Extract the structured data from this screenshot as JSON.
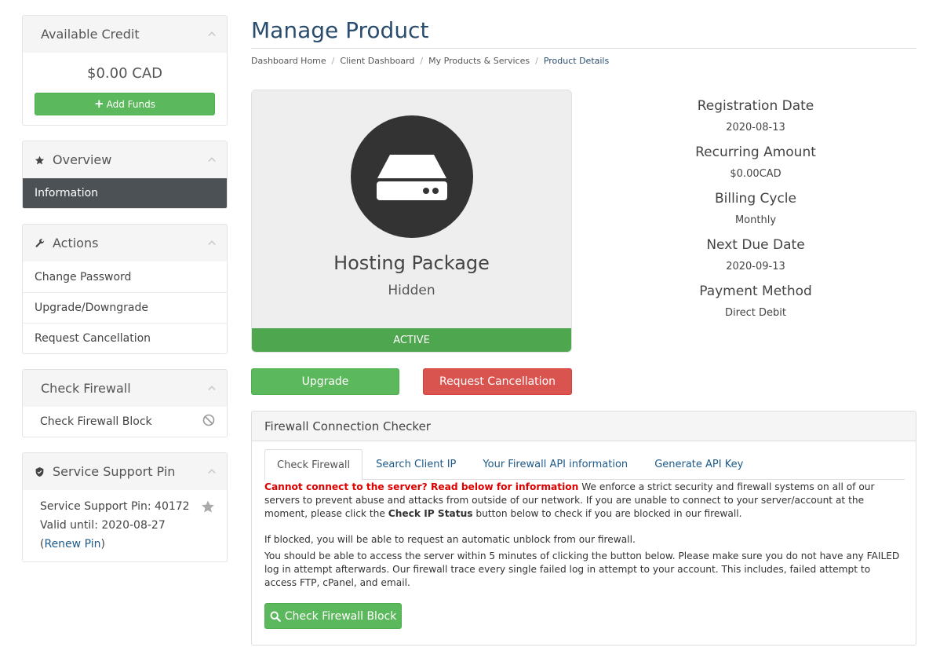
{
  "sidebar": {
    "credit": {
      "title": "Available Credit",
      "amount": "$0.00 CAD",
      "add_funds": "Add Funds"
    },
    "overview": {
      "title": "Overview",
      "active_item": "Information"
    },
    "actions": {
      "title": "Actions",
      "items": [
        "Change Password",
        "Upgrade/Downgrade",
        "Request Cancellation"
      ]
    },
    "firewall": {
      "title": "Check Firewall",
      "item": "Check Firewall Block"
    },
    "support_pin": {
      "title": "Service Support Pin",
      "pin_line": "Service Support Pin: 40172",
      "valid_line": "Valid until: 2020-08-27",
      "open_paren": "(",
      "renew": "Renew Pin",
      "close_paren": ")"
    }
  },
  "page": {
    "title": "Manage Product",
    "breadcrumb": [
      "Dashboard Home",
      "Client Dashboard",
      "My Products & Services",
      "Product Details"
    ],
    "breadcrumb_sep": "/"
  },
  "product": {
    "name": "Hosting Package",
    "subtitle": "Hidden",
    "status": "ACTIVE",
    "icon": "server-icon"
  },
  "buttons": {
    "upgrade": "Upgrade",
    "cancel": "Request Cancellation"
  },
  "details": [
    {
      "label": "Registration Date",
      "value": "2020-08-13"
    },
    {
      "label": "Recurring Amount",
      "value": "$0.00CAD"
    },
    {
      "label": "Billing Cycle",
      "value": "Monthly"
    },
    {
      "label": "Next Due Date",
      "value": "2020-09-13"
    },
    {
      "label": "Payment Method",
      "value": "Direct Debit"
    }
  ],
  "firewall_panel": {
    "title": "Firewall Connection Checker",
    "tabs": [
      "Check Firewall",
      "Search Client IP",
      "Your Firewall API information",
      "Generate API Key"
    ],
    "warning": "Cannot connect to the server? Read below for information",
    "para1_a": " We enforce a strict security and firewall systems on all of our servers to prevent abuse and attacks from outside of our network. If you are unable to connect to your server/account at the moment, please click the ",
    "para1_bold": "Check IP Status",
    "para1_b": " button below to check if you are blocked in our firewall.",
    "para2": "If blocked, you will be able to request an automatic unblock from our firewall.",
    "para3": "You should be able to access the server within 5 minutes of clicking the button below. Please make sure you do not have any FAILED log in attempt afterwards. Our firewall trace every single failed log in attempt to your account. This includes, failed attempt to access FTP, cPanel, and email.",
    "check_button": "Check Firewall Block"
  },
  "colors": {
    "green": "#5cb85c",
    "red": "#d9534f",
    "dark": "#4c5155",
    "title": "#2a4d6e",
    "link": "#1e5a8a"
  }
}
